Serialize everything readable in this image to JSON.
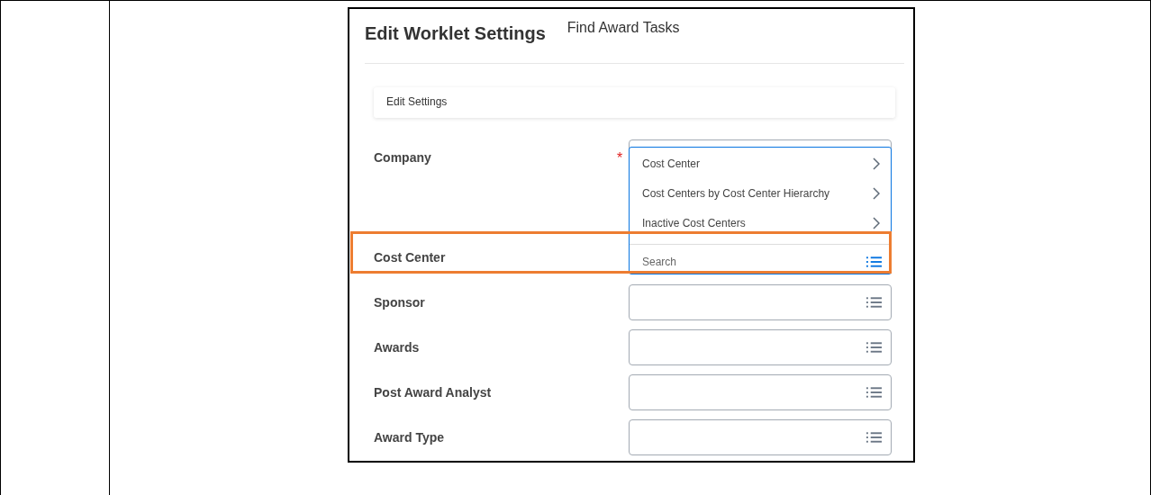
{
  "header": {
    "title": "Edit Worklet Settings",
    "tab": "Find Award Tasks"
  },
  "section": {
    "title": "Edit Settings"
  },
  "required_marker": "*",
  "fields": [
    {
      "label": "Company",
      "required": true,
      "highlighted": false,
      "open": false
    },
    {
      "label": "Cost Center",
      "required": false,
      "highlighted": true,
      "open": true
    },
    {
      "label": "Sponsor",
      "required": false,
      "highlighted": false,
      "open": false
    },
    {
      "label": "Awards",
      "required": false,
      "highlighted": false,
      "open": false
    },
    {
      "label": "Post Award Analyst",
      "required": false,
      "highlighted": false,
      "open": false
    },
    {
      "label": "Award Type",
      "required": false,
      "highlighted": false,
      "open": false
    }
  ],
  "popup": {
    "options": [
      "Cost Center",
      "Cost Centers by Cost Center Hierarchy",
      "Inactive Cost Centers"
    ],
    "search": {
      "placeholder": "Search"
    }
  }
}
